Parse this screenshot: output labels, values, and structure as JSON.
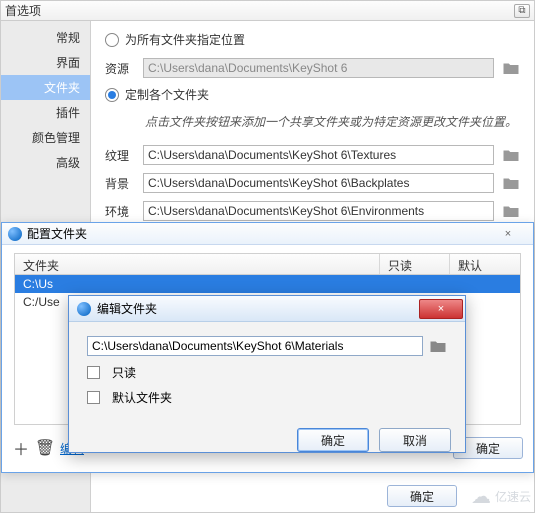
{
  "pref": {
    "title": "首选项",
    "close": "⧉",
    "sidebar": [
      "常规",
      "界面",
      "文件夹",
      "插件",
      "颜色管理",
      "高级"
    ],
    "active_index": 2,
    "radio_all": "为所有文件夹指定位置",
    "radio_custom": "定制各个文件夹",
    "hint": "点击文件夹按钮来添加一个共享文件夹或为特定资源更改文件夹位置。",
    "rows": {
      "resource": {
        "label": "资源",
        "path": "C:\\Users\\dana\\Documents\\KeyShot 6"
      },
      "texture": {
        "label": "纹理",
        "path": "C:\\Users\\dana\\Documents\\KeyShot 6\\Textures"
      },
      "background": {
        "label": "背景",
        "path": "C:\\Users\\dana\\Documents\\KeyShot 6\\Backplates"
      },
      "env": {
        "label": "环境",
        "path": "C:\\Users\\dana\\Documents\\KeyShot 6\\Environments"
      }
    }
  },
  "config": {
    "title": "配置文件夹",
    "close": "×",
    "cols": {
      "folder": "文件夹",
      "readonly": "只读",
      "default": "默认"
    },
    "rows": [
      {
        "path": "C:\\Us"
      },
      {
        "path": "C:/Use"
      }
    ],
    "plus": "＋",
    "trash": "🗑",
    "edit": "编辑",
    "ok": "确定"
  },
  "edit": {
    "title": "编辑文件夹",
    "path": "C:\\Users\\dana\\Documents\\KeyShot 6\\Materials",
    "readonly": "只读",
    "default": "默认文件夹",
    "ok": "确定",
    "cancel": "取消",
    "close": "×"
  },
  "page_ok": "确定",
  "watermark": "亿速云"
}
